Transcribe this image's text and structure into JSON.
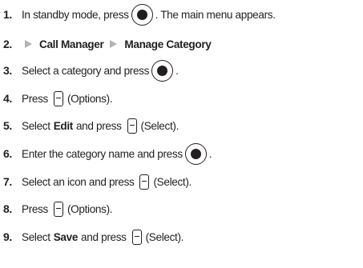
{
  "steps": [
    {
      "num": "1.",
      "parts": [
        "In standby mode, press",
        ". The main menu appears."
      ]
    },
    {
      "num": "2.",
      "parts": [
        "Call Manager",
        "Manage Category"
      ]
    },
    {
      "num": "3.",
      "parts": [
        "Select a category and press",
        "."
      ]
    },
    {
      "num": "4.",
      "parts": [
        "Press",
        "(Options)."
      ]
    },
    {
      "num": "5.",
      "parts": [
        "Select",
        "Edit",
        "and press",
        "(Select)."
      ]
    },
    {
      "num": "6.",
      "parts": [
        "Enter the category name and press",
        "."
      ]
    },
    {
      "num": "7.",
      "parts": [
        "Select an icon and press",
        "(Select)."
      ]
    },
    {
      "num": "8.",
      "parts": [
        "Press",
        "(Options)."
      ]
    },
    {
      "num": "9.",
      "parts": [
        "Select",
        "Save",
        "and press",
        "(Select)."
      ]
    }
  ],
  "icons": {
    "center_key": "center-navigation-key-icon",
    "soft_key": "left-soft-key-icon",
    "menu_arrow": "menu-path-arrow-icon"
  },
  "colors": {
    "text": "#231f20",
    "arrow": "#b3b3b3"
  }
}
